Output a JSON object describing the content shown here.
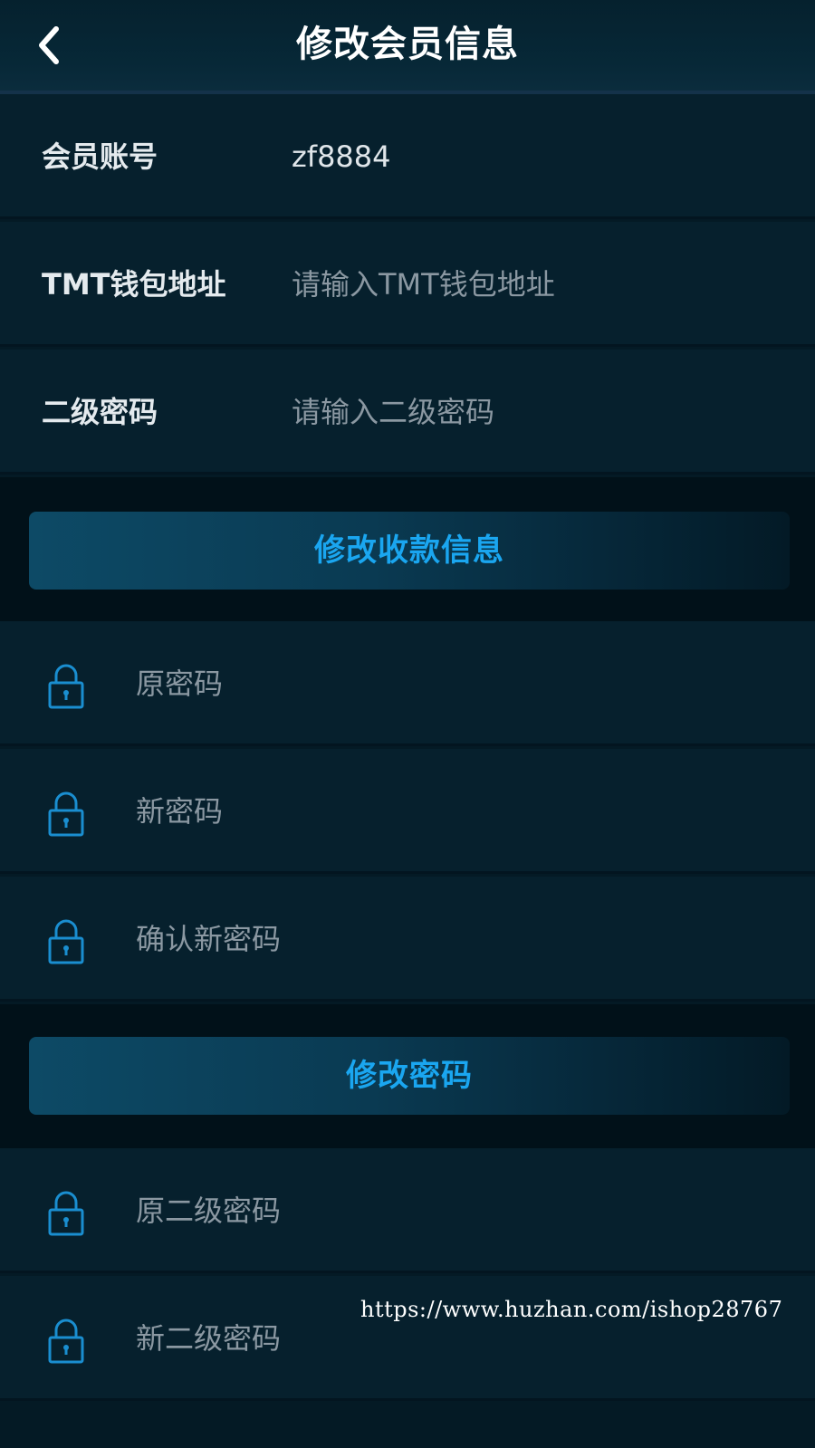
{
  "header": {
    "title": "修改会员信息",
    "back_icon": "chevron-left-icon"
  },
  "member_info": {
    "account_label": "会员账号",
    "account_value": "zf8884",
    "wallet_label": "TMT钱包地址",
    "wallet_placeholder": "请输入TMT钱包地址",
    "secondary_pwd_label": "二级密码",
    "secondary_pwd_placeholder": "请输入二级密码",
    "submit_label": "修改收款信息"
  },
  "password_change": {
    "old_placeholder": "原密码",
    "new_placeholder": "新密码",
    "confirm_placeholder": "确认新密码",
    "submit_label": "修改密码"
  },
  "secondary_password_change": {
    "old_placeholder": "原二级密码",
    "new_placeholder": "新二级密码"
  },
  "watermark": "https://www.huzhan.com/ishop28767",
  "colors": {
    "background": "#041a25",
    "accent": "#1aa6f0",
    "lock_icon": "#1a8ed0"
  }
}
